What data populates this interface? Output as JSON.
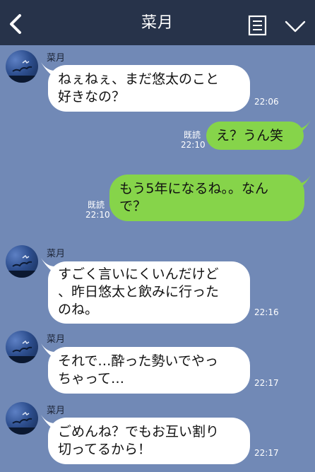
{
  "header": {
    "title": "菜月"
  },
  "messages": [
    {
      "sender": "菜月",
      "text": "ねぇねぇ、まだ悠太のこと\n好きなの？",
      "time": "22:06"
    },
    {
      "text": "え？うん笑",
      "read": "既読",
      "time": "22:10"
    },
    {
      "text": "もう5年になるね。。なん\nで？",
      "read": "既読",
      "time": "22:10"
    },
    {
      "sender": "菜月",
      "text": "すごく言いにくいんだけど\n、昨日悠太と飲みに行った\nのね。",
      "time": "22:16"
    },
    {
      "sender": "菜月",
      "text": "それで…酔った勢いでやっ\nちゃって…",
      "time": "22:17"
    },
    {
      "sender": "菜月",
      "text": "ごめんね？でもお互い割り\n切ってるから！",
      "time": "22:17"
    }
  ],
  "colors": {
    "background": "#7189b6",
    "header": "#27334a",
    "incoming_bubble": "#ffffff",
    "outgoing_bubble": "#86d44a"
  }
}
